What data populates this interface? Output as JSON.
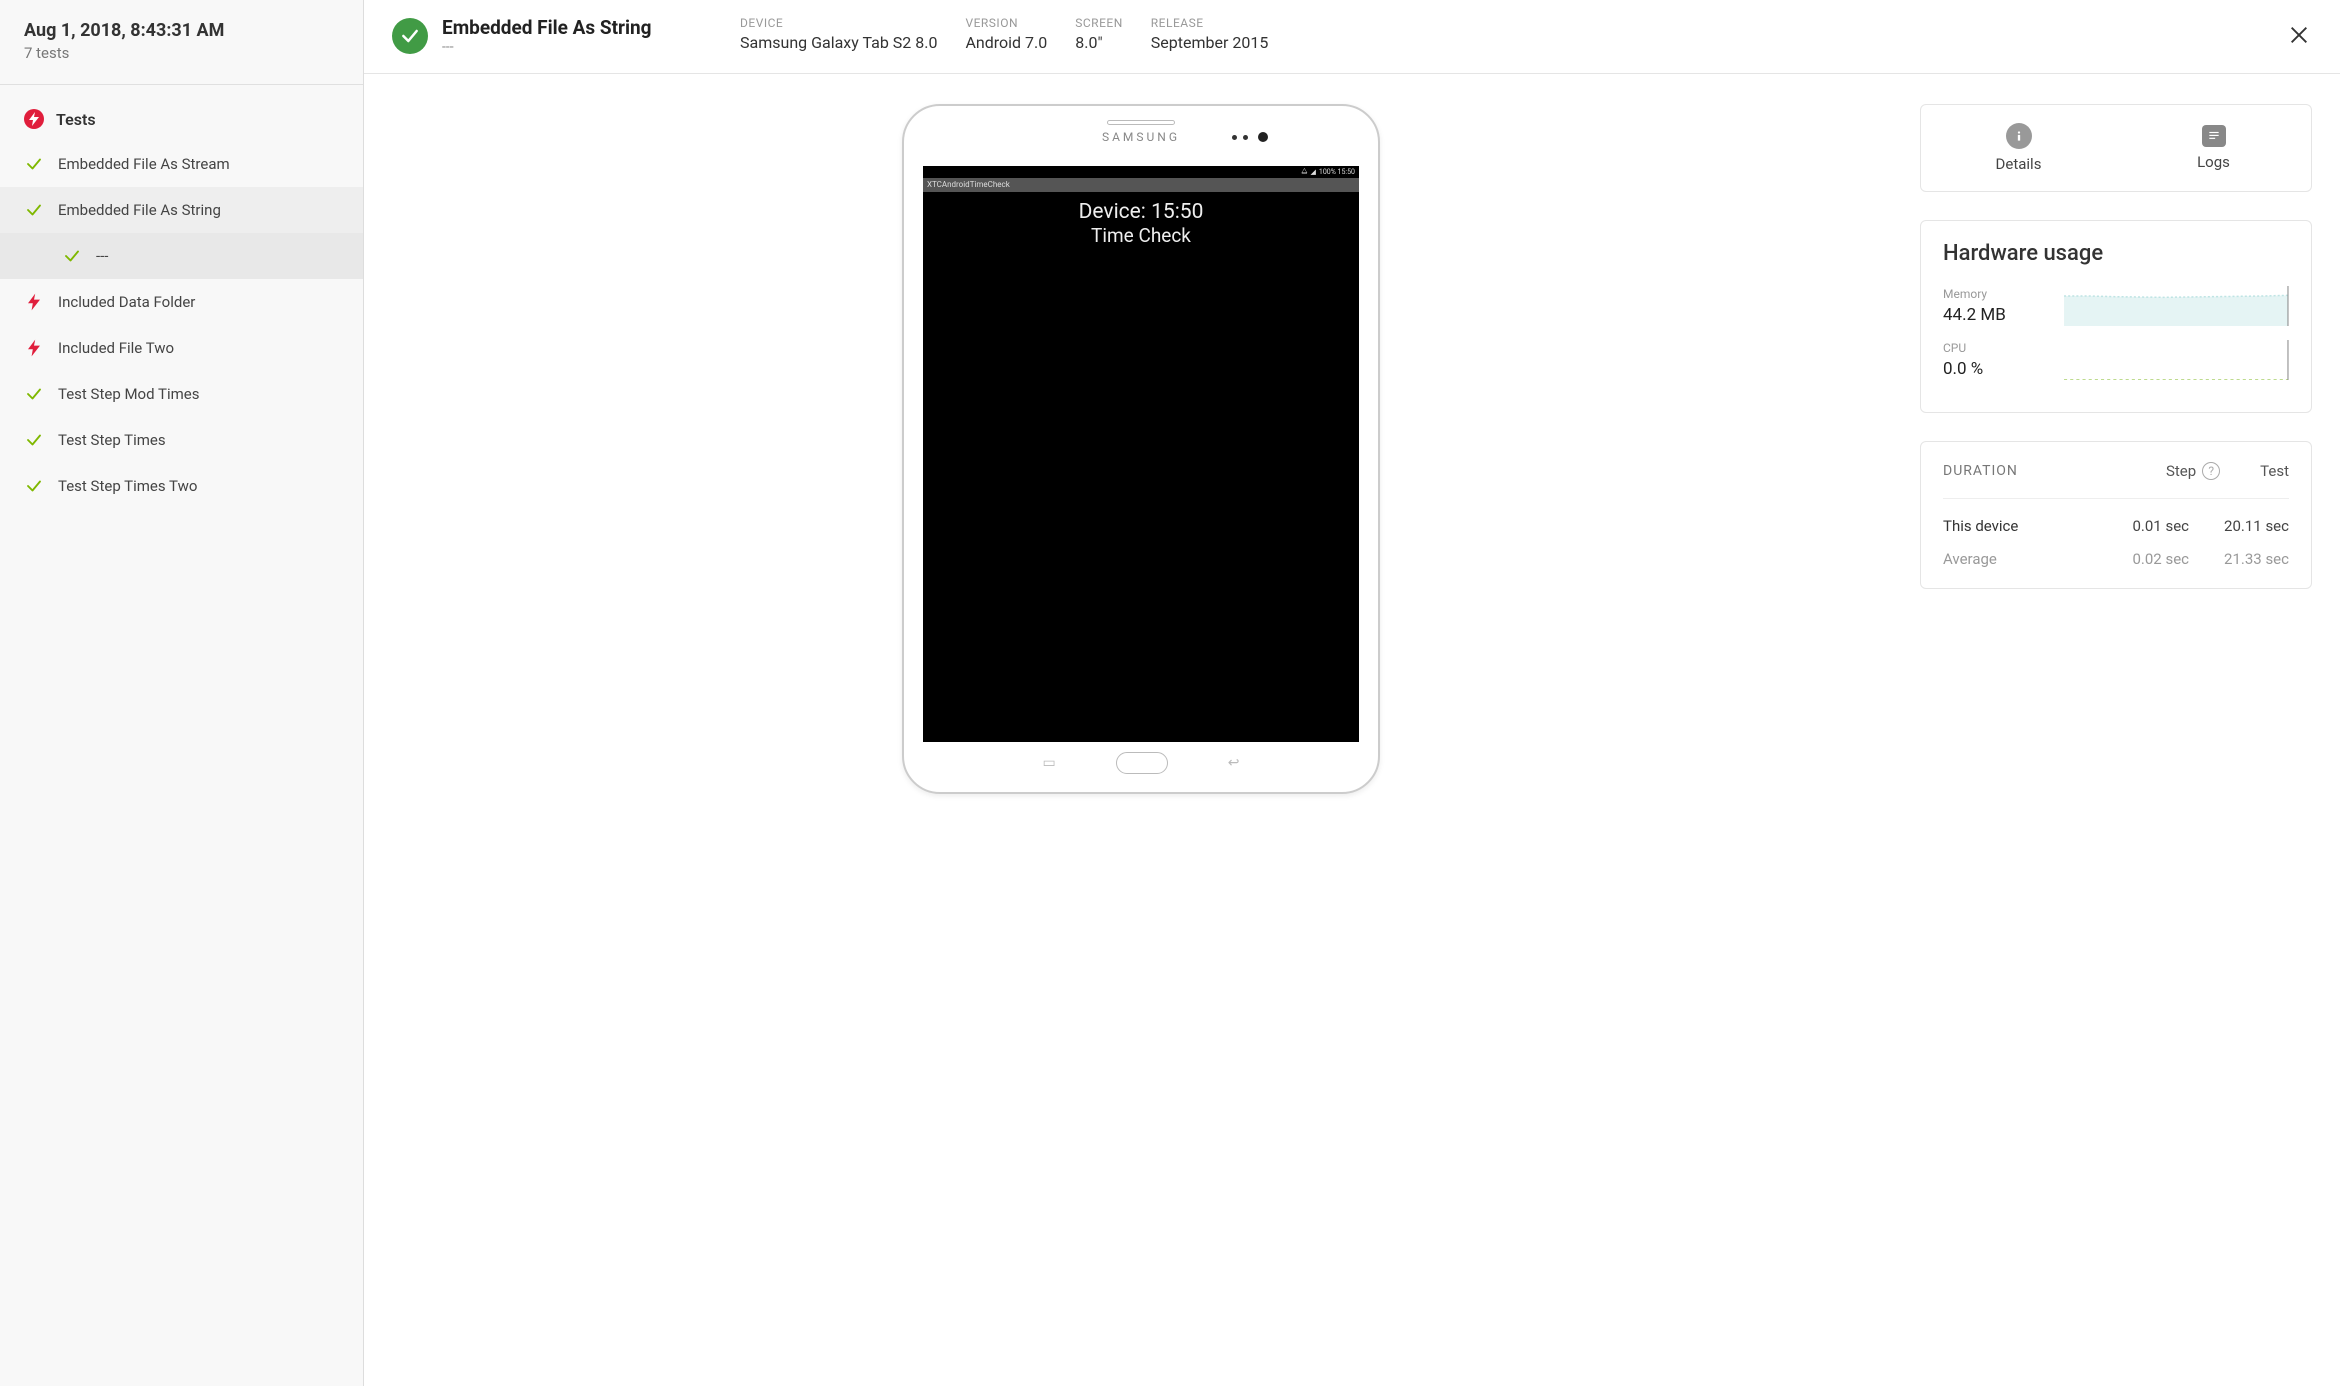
{
  "sidebar": {
    "timestamp": "Aug 1, 2018, 8:43:31 AM",
    "test_count": "7 tests",
    "section_title": "Tests",
    "items": [
      {
        "label": "Embedded File As Stream",
        "status": "pass"
      },
      {
        "label": "Embedded File As String",
        "status": "pass",
        "selected": true,
        "sub": {
          "label": "---",
          "status": "pass"
        }
      },
      {
        "label": "Included Data Folder",
        "status": "fail"
      },
      {
        "label": "Included File Two",
        "status": "fail"
      },
      {
        "label": "Test Step Mod Times",
        "status": "pass"
      },
      {
        "label": "Test Step Times",
        "status": "pass"
      },
      {
        "label": "Test Step Times Two",
        "status": "pass"
      }
    ]
  },
  "header": {
    "title": "Embedded File As String",
    "subtitle": "---",
    "meta": [
      {
        "label": "DEVICE",
        "value": "Samsung Galaxy Tab S2 8.0"
      },
      {
        "label": "VERSION",
        "value": "Android 7.0"
      },
      {
        "label": "SCREEN",
        "value": "8.0\""
      },
      {
        "label": "RELEASE",
        "value": "September 2015"
      }
    ]
  },
  "device_preview": {
    "brand": "SAMSUNG",
    "statusbar_right": "100%  15:50",
    "app_title_bar": "XTCAndroidTimeCheck",
    "line1": "Device: 15:50",
    "line2": "Time Check"
  },
  "tabs": {
    "details": "Details",
    "logs": "Logs"
  },
  "hardware": {
    "title": "Hardware usage",
    "memory_label": "Memory",
    "memory_value": "44.2 MB",
    "cpu_label": "CPU",
    "cpu_value": "0.0 %"
  },
  "duration": {
    "title": "DURATION",
    "step_label": "Step",
    "test_label": "Test",
    "rows": [
      {
        "label": "This device",
        "step": "0.01 sec",
        "test": "20.11 sec"
      },
      {
        "label": "Average",
        "step": "0.02 sec",
        "test": "21.33 sec"
      }
    ]
  },
  "chart_data": [
    {
      "type": "area",
      "name": "Memory",
      "color": "#bfe4e4",
      "values": [
        45,
        45,
        44,
        43.5,
        43,
        43.5,
        44,
        44.5,
        45,
        46
      ],
      "ylim": [
        0,
        60
      ]
    },
    {
      "type": "line",
      "name": "CPU",
      "color": "#a8cf6a",
      "values": [
        0,
        0,
        0,
        0,
        0,
        0,
        0,
        0,
        0,
        0
      ],
      "ylim": [
        0,
        100
      ]
    }
  ]
}
